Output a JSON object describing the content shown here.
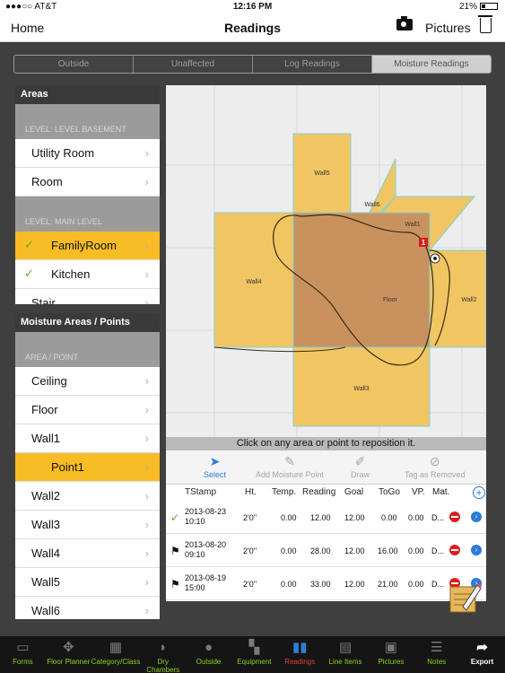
{
  "status": {
    "carrier": "●●●○○ AT&T",
    "wifi": "wifi-icon",
    "time": "12:16 PM",
    "battery": "21%"
  },
  "navbar": {
    "home": "Home",
    "title": "Readings",
    "pictures": "Pictures"
  },
  "segments": [
    {
      "label": "Outside",
      "selected": false
    },
    {
      "label": "Unaffected",
      "selected": false
    },
    {
      "label": "Log Readings",
      "selected": false
    },
    {
      "label": "Moisture Readings",
      "selected": true
    }
  ],
  "areas": {
    "title": "Areas",
    "level1": "LEVEL: LEVEL BASEMENT",
    "level1_items": [
      "Utility Room",
      "Room"
    ],
    "level2": "LEVEL: MAIN LEVEL",
    "level2_items": [
      {
        "label": "FamilyRoom",
        "checked": true,
        "selected": true
      },
      {
        "label": "Kitchen",
        "checked": true,
        "selected": false
      },
      {
        "label": "Stair",
        "checked": false,
        "selected": false
      }
    ]
  },
  "moisture": {
    "title": "Moisture Areas / Points",
    "section": "AREA / POINT",
    "items": [
      {
        "label": "Ceiling"
      },
      {
        "label": "Floor"
      },
      {
        "label": "Wall1"
      },
      {
        "label": "Point1",
        "selected": true
      },
      {
        "label": "Wall2"
      },
      {
        "label": "Wall3"
      },
      {
        "label": "Wall4"
      },
      {
        "label": "Wall5"
      },
      {
        "label": "Wall6"
      }
    ]
  },
  "diagram": {
    "labels": {
      "wall1": "Wall1",
      "wall2": "Wall2",
      "wall3": "Wall3",
      "wall4": "Wall4",
      "wall5": "Wall5",
      "wall6": "Wall6",
      "floor": "Floor"
    },
    "point_marker": "1",
    "colors": {
      "wall": "#f2c563",
      "floor": "#c8925e",
      "outline": "#7fd1d8"
    }
  },
  "caption": "Click on any area or point to reposition it.",
  "tools": {
    "select": "Select",
    "add_point": "Add Moisture Point",
    "draw": "Draw",
    "tag_removed": "Tag as Removed"
  },
  "table": {
    "headers": {
      "tstamp": "TStamp",
      "ht": "Ht.",
      "temp": "Temp.",
      "reading": "Reading",
      "goal": "Goal",
      "togo": "ToGo",
      "vp": "VP.",
      "mat": "Mat."
    },
    "rows": [
      {
        "date": "2013-08-23",
        "time": "10:10",
        "ht": "2'0''",
        "temp": "0.00",
        "reading": "12.00",
        "goal": "12.00",
        "togo": "0.00",
        "vp": "0.00",
        "mat": "D...",
        "status": "check"
      },
      {
        "date": "2013-08-20",
        "time": "09:10",
        "ht": "2'0''",
        "temp": "0.00",
        "reading": "28.00",
        "goal": "12.00",
        "togo": "16.00",
        "vp": "0.00",
        "mat": "D...",
        "status": "flag"
      },
      {
        "date": "2013-08-19",
        "time": "15:00",
        "ht": "2'0''",
        "temp": "0.00",
        "reading": "33.00",
        "goal": "12.00",
        "togo": "21.00",
        "vp": "0.00",
        "mat": "D...",
        "status": "flag"
      }
    ]
  },
  "tabbar": [
    {
      "label": "Forms",
      "icon": "briefcase-icon"
    },
    {
      "label": "Floor Planner",
      "icon": "move-icon"
    },
    {
      "label": "Category/Class",
      "icon": "grid-icon"
    },
    {
      "label": "Dry Chambers",
      "icon": "hairdryer-icon"
    },
    {
      "label": "Outside",
      "icon": "location-pin-icon"
    },
    {
      "label": "Equipment",
      "icon": "drill-icon"
    },
    {
      "label": "Readings",
      "icon": "bar-chart-icon",
      "active": true
    },
    {
      "label": "Line Items",
      "icon": "tray-icon"
    },
    {
      "label": "Pictures",
      "icon": "picture-frame-icon"
    },
    {
      "label": "Notes",
      "icon": "notes-icon"
    },
    {
      "label": "Export",
      "icon": "export-arrow-icon"
    }
  ]
}
